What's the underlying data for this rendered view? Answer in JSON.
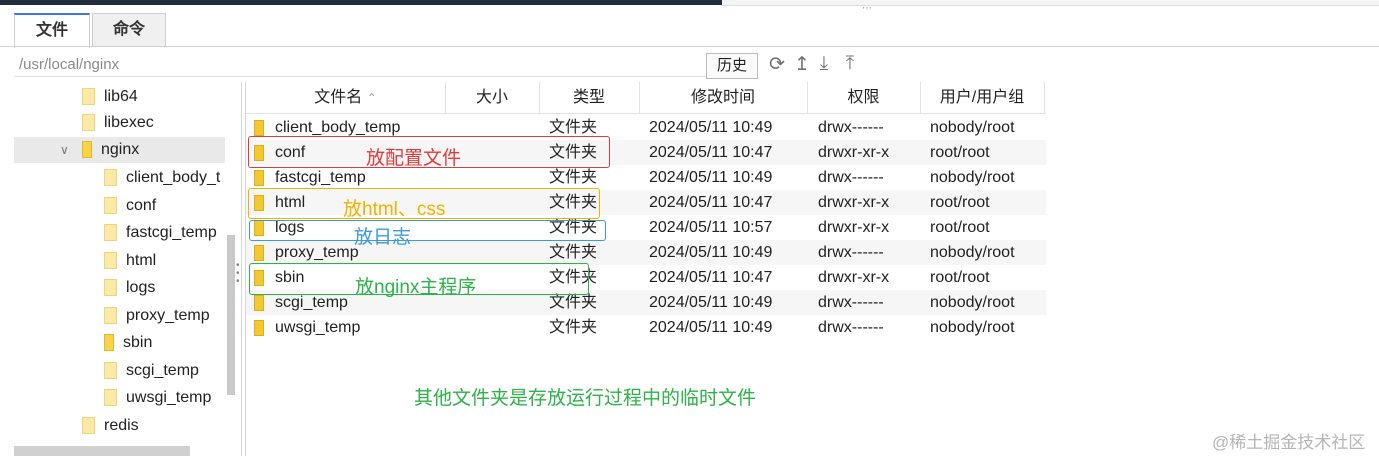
{
  "tabs": [
    {
      "label": "文件",
      "active": true
    },
    {
      "label": "命令",
      "active": false
    }
  ],
  "path_bar": {
    "value": "/usr/local/nginx",
    "history_button": "历史"
  },
  "toolbar": {
    "icons": [
      "refresh-icon",
      "up-icon",
      "download-icon",
      "upload-icon"
    ]
  },
  "tree": {
    "items": [
      {
        "label": "lib64"
      },
      {
        "label": "libexec"
      },
      {
        "label": "nginx",
        "expanded": true,
        "selected": true
      },
      {
        "label": "client_body_t"
      },
      {
        "label": "conf"
      },
      {
        "label": "fastcgi_temp"
      },
      {
        "label": "html"
      },
      {
        "label": "logs"
      },
      {
        "label": "proxy_temp"
      },
      {
        "label": "sbin"
      },
      {
        "label": "scgi_temp"
      },
      {
        "label": "uwsgi_temp"
      },
      {
        "label": "redis"
      }
    ]
  },
  "table": {
    "headers": {
      "name": "文件名",
      "size": "大小",
      "type": "类型",
      "mtime": "修改时间",
      "perm": "权限",
      "owner": "用户/用户组"
    },
    "sort_indicator": "^",
    "rows": [
      {
        "name": "client_body_temp",
        "type": "文件夹",
        "mtime": "2024/05/11 10:49",
        "perm": "drwx------",
        "owner": "nobody/root"
      },
      {
        "name": "conf",
        "type": "文件夹",
        "mtime": "2024/05/11 10:47",
        "perm": "drwxr-xr-x",
        "owner": "root/root"
      },
      {
        "name": "fastcgi_temp",
        "type": "文件夹",
        "mtime": "2024/05/11 10:49",
        "perm": "drwx------",
        "owner": "nobody/root"
      },
      {
        "name": "html",
        "type": "文件夹",
        "mtime": "2024/05/11 10:47",
        "perm": "drwxr-xr-x",
        "owner": "root/root"
      },
      {
        "name": "logs",
        "type": "文件夹",
        "mtime": "2024/05/11 10:57",
        "perm": "drwxr-xr-x",
        "owner": "root/root"
      },
      {
        "name": "proxy_temp",
        "type": "文件夹",
        "mtime": "2024/05/11 10:49",
        "perm": "drwx------",
        "owner": "nobody/root"
      },
      {
        "name": "sbin",
        "type": "文件夹",
        "mtime": "2024/05/11 10:47",
        "perm": "drwxr-xr-x",
        "owner": "root/root"
      },
      {
        "name": "scgi_temp",
        "type": "文件夹",
        "mtime": "2024/05/11 10:49",
        "perm": "drwx------",
        "owner": "nobody/root"
      },
      {
        "name": "uwsgi_temp",
        "type": "文件夹",
        "mtime": "2024/05/11 10:49",
        "perm": "drwx------",
        "owner": "nobody/root"
      }
    ]
  },
  "annotations": {
    "conf": {
      "text": "放配置文件",
      "color": "#e03c3c"
    },
    "html": {
      "text": "放html、css",
      "color": "#f0b400"
    },
    "logs": {
      "text": "放日志",
      "color": "#3b9ae0"
    },
    "sbin": {
      "text": "放nginx主程序",
      "color": "#2db34a"
    },
    "others": {
      "text": "其他文件夹是存放运行过程中的临时文件",
      "color": "#2db34a"
    }
  },
  "watermark": "@稀土掘金技术社区"
}
